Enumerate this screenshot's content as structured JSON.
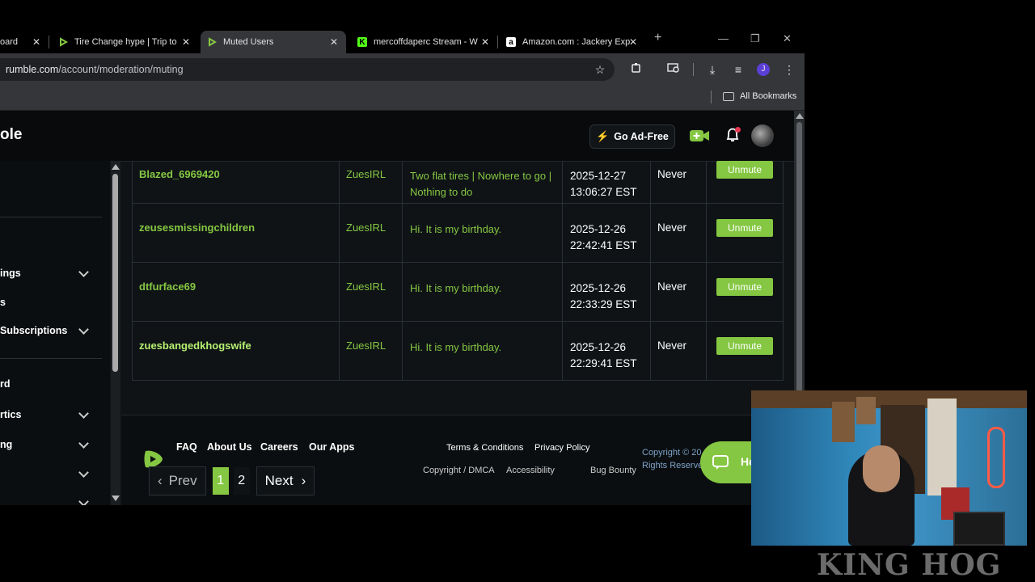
{
  "browser": {
    "tabs": [
      {
        "label": "oard",
        "favicon": ""
      },
      {
        "label": "Tire Change hype | Trip to",
        "favicon": "rumble"
      },
      {
        "label": "Muted Users",
        "favicon": "rumble"
      },
      {
        "label": "mercoffdaperc Stream - W",
        "favicon": "kick"
      },
      {
        "label": "Amazon.com : Jackery Exp",
        "favicon": "amazon"
      }
    ],
    "new_tab": "+",
    "url_domain": "rumble.com",
    "url_path": "/account/moderation/muting",
    "bookmarks_label": "All Bookmarks",
    "profile_initial": "J"
  },
  "site": {
    "logo_partial": "ole",
    "ad_free_label": "Go Ad-Free",
    "accent": "#85c742"
  },
  "sidebar": {
    "items": [
      {
        "label": "ings",
        "chevron": true
      },
      {
        "label": "s",
        "chevron": false
      },
      {
        "label": "Subscriptions",
        "chevron": true
      },
      {
        "label": "rd",
        "chevron": false
      },
      {
        "label": "rtics",
        "chevron": true
      },
      {
        "label": "ng",
        "chevron": true
      },
      {
        "label": "",
        "chevron": true
      }
    ]
  },
  "muted_users": [
    {
      "username": "Blazed_6969420",
      "muted_by": "ZuesIRL",
      "reason": "Two flat tires | Nowhere to go | Nothing to do",
      "date": "2025-12-27",
      "time": "13:06:27 EST",
      "expires": "Never",
      "action": "Unmute"
    },
    {
      "username": "zeusesmissingchildren",
      "muted_by": "ZuesIRL",
      "reason": "Hi. It is my birthday.",
      "date": "2025-12-26",
      "time": "22:42:41 EST",
      "expires": "Never",
      "action": "Unmute"
    },
    {
      "username": "dtfurface69",
      "muted_by": "ZuesIRL",
      "reason": "Hi. It is my birthday.",
      "date": "2025-12-26",
      "time": "22:33:29 EST",
      "expires": "Never",
      "action": "Unmute"
    },
    {
      "username": "zuesbangedkhogswife",
      "muted_by": "ZuesIRL",
      "reason": "Hi. It is my birthday.",
      "date": "2025-12-26",
      "time": "22:29:41 EST",
      "expires": "Never",
      "action": "Unmute"
    }
  ],
  "pagination": {
    "prev": "Prev",
    "pages": [
      "1",
      "2"
    ],
    "current": "1",
    "next": "Next"
  },
  "footer": {
    "links": [
      "FAQ",
      "About Us",
      "Careers",
      "Our Apps"
    ],
    "legal_row1": [
      "Terms & Conditions",
      "Privacy Policy"
    ],
    "legal_row2": [
      "Copyright / DMCA",
      "Accessibility",
      "Bug Bounty"
    ],
    "copyright_line1": "Copyright © 20",
    "copyright_line2": "Rights Reserve",
    "help_label": "He"
  },
  "overlay": {
    "streamer_brand": "KING HOG"
  }
}
